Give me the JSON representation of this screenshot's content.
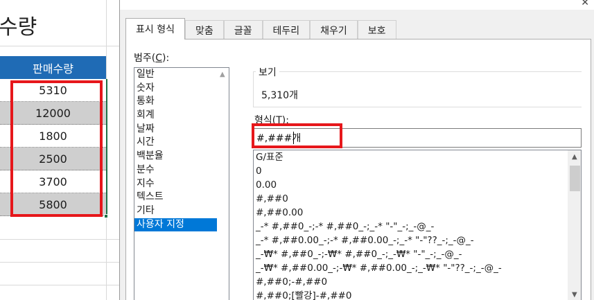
{
  "sheet": {
    "title": "수량",
    "column_header": "판매수량",
    "values": [
      "5310",
      "12000",
      "1800",
      "2500",
      "3700",
      "5800"
    ]
  },
  "dialog": {
    "tabs": [
      "표시 형식",
      "맞춤",
      "글꼴",
      "테두리",
      "채우기",
      "보호"
    ],
    "active_tab": "표시 형식",
    "category_label": "범주(C):",
    "category_label_parts": {
      "pre": "범주(",
      "key": "C",
      "post": "):"
    },
    "categories": [
      "일반",
      "숫자",
      "통화",
      "회계",
      "날짜",
      "시간",
      "백분율",
      "분수",
      "지수",
      "텍스트",
      "기타",
      "사용자 지정"
    ],
    "selected_category": "사용자 지정",
    "sample_legend": "보기",
    "sample_value": "5,310개",
    "format_label_parts": {
      "pre": "형식(",
      "key": "T",
      "post": "):"
    },
    "format_value": "#,###개",
    "format_list": [
      "G/표준",
      "0",
      "0.00",
      "#,##0",
      "#,##0.00",
      "_-* #,##0_-;-* #,##0_-;_-* \"-\"_-;_-@_-",
      "_-* #,##0.00_-;-* #,##0.00_-;_-* \"-\"??_-;_-@_-",
      "_-₩* #,##0_-;-₩* #,##0_-;_-₩* \"-\"_-;_-@_-",
      "_-₩* #,##0.00_-;-₩* #,##0.00_-;_-₩* \"-\"??_-;_-@_-",
      "#,##0;-#,##0",
      "#,##0;[빨강]-#,##0"
    ]
  },
  "colors": {
    "header_blue": "#1f6bb5",
    "highlight_red": "#e6171b",
    "selection_blue": "#0078d7"
  }
}
